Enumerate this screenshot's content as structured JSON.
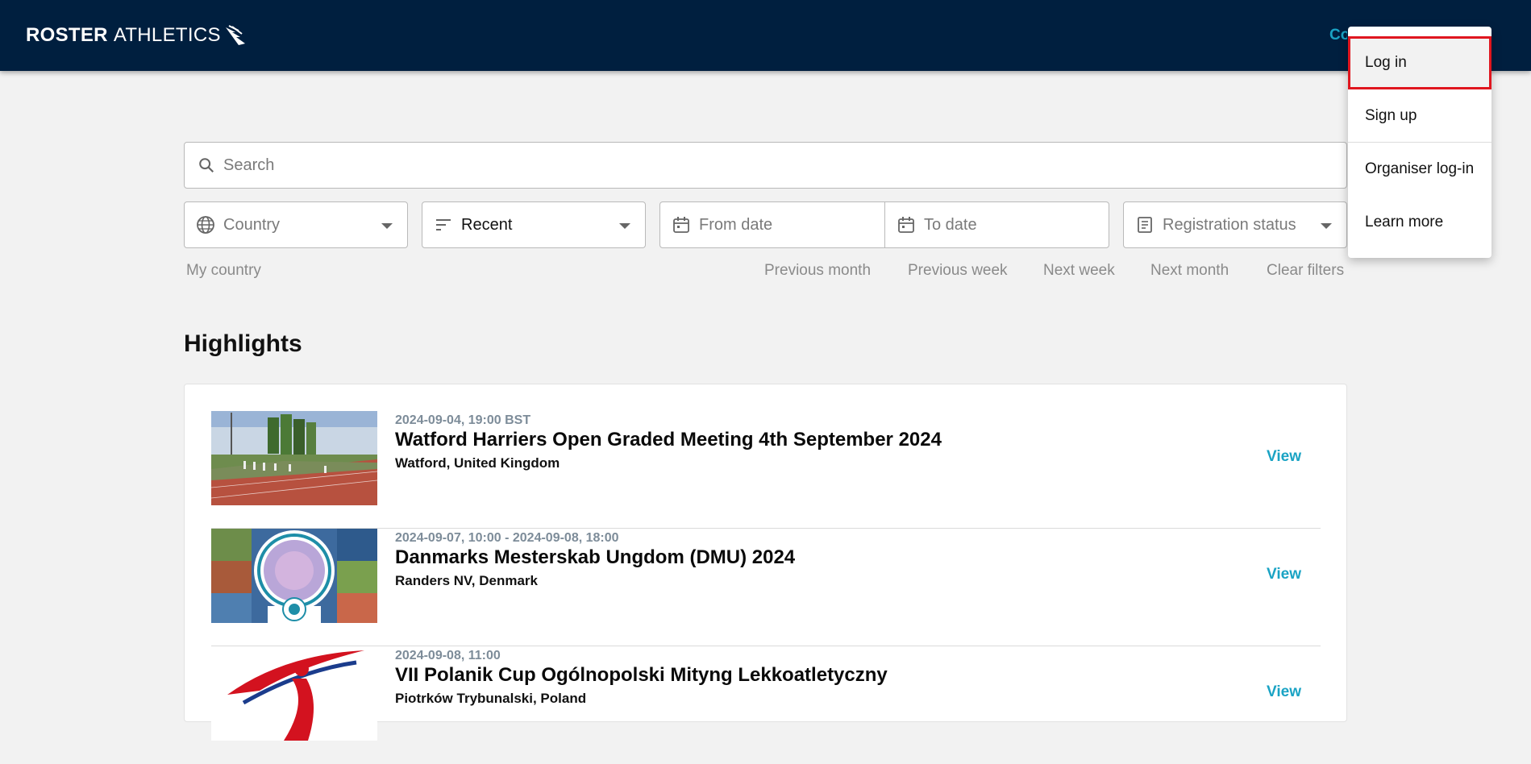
{
  "header": {
    "logo_bold": "ROSTER",
    "logo_light": "ATHLETICS",
    "link_partial": "Co"
  },
  "search": {
    "placeholder": "Search"
  },
  "filters": {
    "country": "Country",
    "sort": "Recent",
    "from_date": "From date",
    "to_date": "To date",
    "registration": "Registration status"
  },
  "quick_filters": {
    "my_country": "My country",
    "previous_month": "Previous month",
    "previous_week": "Previous week",
    "next_week": "Next week",
    "next_month": "Next month",
    "clear": "Clear filters"
  },
  "highlights": {
    "title": "Highlights",
    "events": [
      {
        "date": "2024-09-04, 19:00 BST",
        "name": "Watford Harriers Open Graded Meeting 4th September 2024",
        "location": "Watford, United Kingdom",
        "action": "View"
      },
      {
        "date": "2024-09-07, 10:00 - 2024-09-08, 18:00",
        "name": "Danmarks Mesterskab Ungdom (DMU) 2024",
        "location": "Randers NV, Denmark",
        "action": "View"
      },
      {
        "date": "2024-09-08, 11:00",
        "name": "VII Polanik Cup Ogólnopolski Mityng Lekkoatletyczny",
        "location": "Piotrków Trybunalski, Poland",
        "action": "View"
      }
    ]
  },
  "menu": {
    "items": [
      "Log in",
      "Sign up",
      "Organiser log-in",
      "Learn more"
    ],
    "selected": "Log in"
  },
  "colors": {
    "header_bg": "#001f3f",
    "accent": "#1aa3c4",
    "selection_outline": "#e0161f"
  },
  "icons": [
    "wing-icon",
    "search-icon",
    "globe-icon",
    "sort-icon",
    "calendar-icon",
    "document-icon",
    "chevron-down-icon"
  ]
}
